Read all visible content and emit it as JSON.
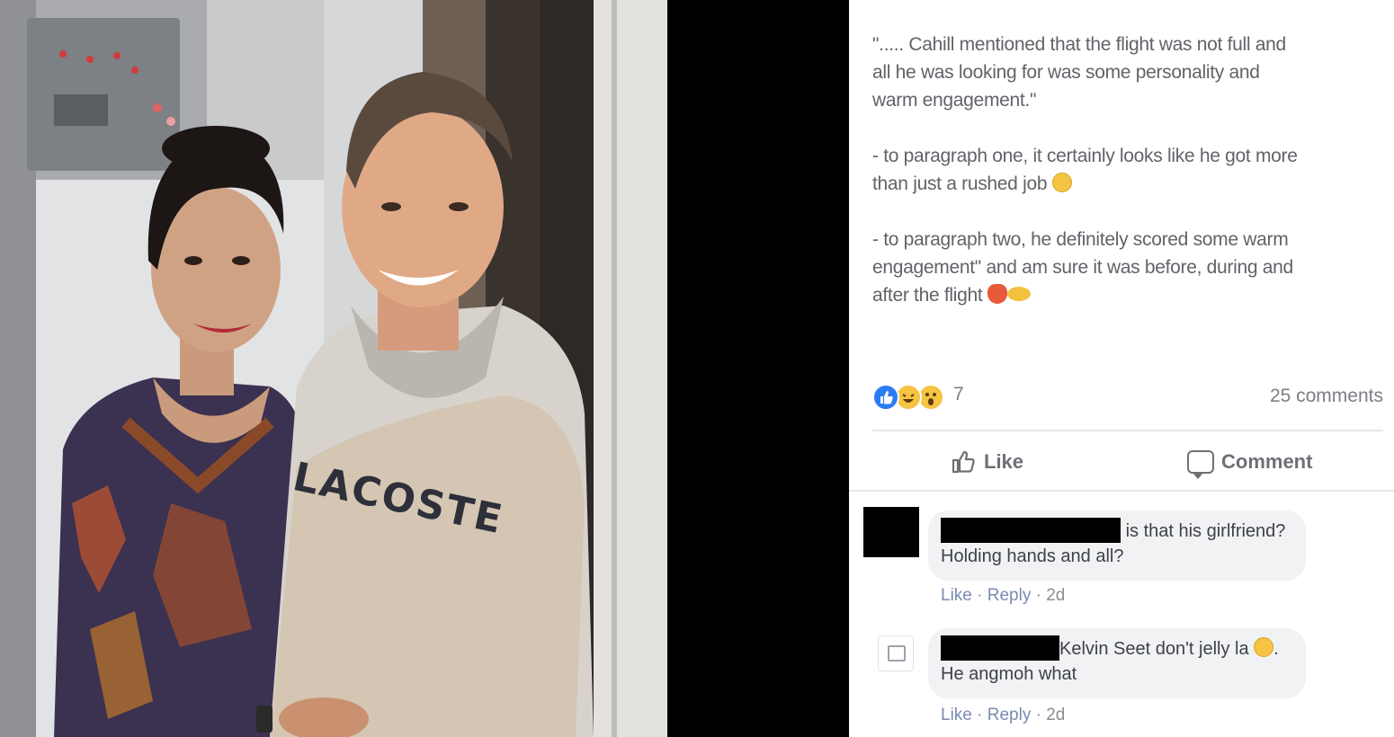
{
  "photo": {
    "hoodie_text": "LACOSTE"
  },
  "post": {
    "caption": [
      "\"..... Cahill mentioned that the flight was not full and\nall he was looking for was some personality and\nwarm engagement.\"",
      "- to paragraph one, it certainly looks like he got more\nthan just a rushed job",
      "- to paragraph two, he definitely scored some warm\nengagement\" and am sure it was before, during and\nafter the flight"
    ],
    "reactions": {
      "icons": [
        "like-reaction-icon",
        "haha-reaction-icon",
        "wow-reaction-icon"
      ],
      "count": "7"
    },
    "comments_count": "25 comments",
    "actions": {
      "like_label": "Like",
      "comment_label": "Comment"
    }
  },
  "comments": [
    {
      "text_line1": "is that his girlfriend?",
      "text_line2": "Holding hands and all?",
      "like": "Like",
      "reply": "Reply",
      "time": "2d"
    },
    {
      "text_line1": "Kelvin Seet don't jelly la",
      "text_line2": "He angmoh what",
      "trailing": ".",
      "like": "Like",
      "reply": "Reply",
      "time": "2d"
    }
  ],
  "colors": {
    "facebook_blue": "#2d7cf6",
    "reaction_yellow": "#f6c343",
    "bubble_bg": "#f1f2f4"
  }
}
